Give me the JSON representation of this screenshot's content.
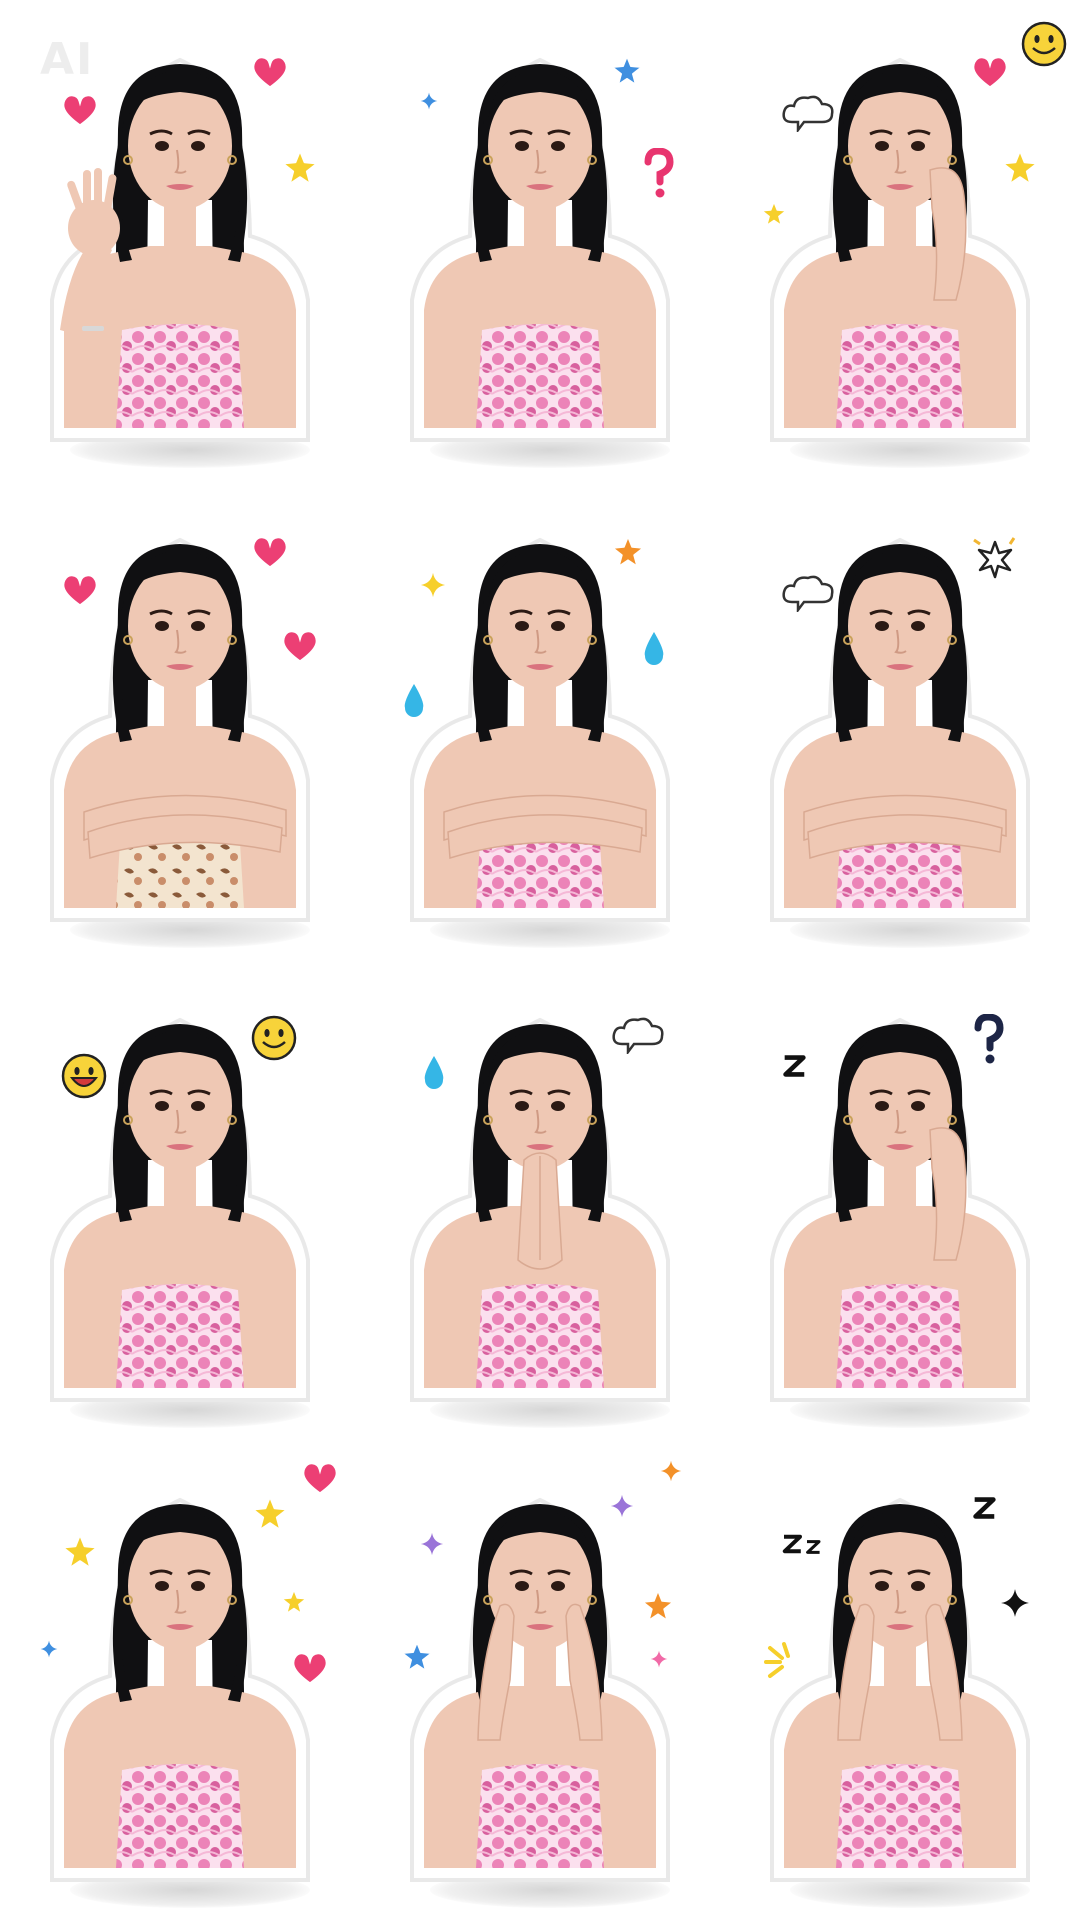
{
  "watermark": "AI",
  "colors": {
    "background": "#ffffff",
    "hair": "#101012",
    "skin": "#efc8b4",
    "dress_pink": "#ec84b8",
    "dress_light": "#fbe0ee",
    "heart": "#ec3f74",
    "star_yellow": "#f6cf2b",
    "star_blue": "#3f8fe0",
    "star_orange": "#f39129",
    "drop_blue": "#35b6e6",
    "question": "#e8356f",
    "question_dark": "#1d2546",
    "smiley": "#f7d33a"
  },
  "stickers": [
    {
      "id": "waving-hello",
      "pose": "wave",
      "outfit": "pink",
      "decos": [
        "heart",
        "heart",
        "star-yellow"
      ]
    },
    {
      "id": "laughing-wink",
      "pose": "neutral",
      "outfit": "pink",
      "decos": [
        "star-blue",
        "star-small-blue",
        "question-pink"
      ]
    },
    {
      "id": "thinking-chin-hand",
      "pose": "cheek-right",
      "outfit": "pink",
      "decos": [
        "heart",
        "cloud",
        "star-yellow",
        "star-yellow-small",
        "smiley"
      ]
    },
    {
      "id": "blowing-bubble",
      "pose": "arms-crossed",
      "outfit": "floral",
      "decos": [
        "heart",
        "heart",
        "heart"
      ]
    },
    {
      "id": "pouting-kiss",
      "pose": "arms-crossed",
      "outfit": "pink",
      "decos": [
        "star-orange",
        "sparkle-yellow",
        "drop",
        "drop"
      ]
    },
    {
      "id": "annoyed-wink",
      "pose": "arms-crossed",
      "outfit": "pink",
      "decos": [
        "burst",
        "cloud"
      ]
    },
    {
      "id": "calm-neutral",
      "pose": "neutral",
      "outfit": "pink",
      "decos": [
        "smiley",
        "smiley-grin"
      ]
    },
    {
      "id": "pleading-hands",
      "pose": "pray",
      "outfit": "pink",
      "decos": [
        "cloud",
        "drop"
      ]
    },
    {
      "id": "sleepy-frown",
      "pose": "cheek-right",
      "outfit": "pink",
      "decos": [
        "question-dark",
        "z-single"
      ]
    },
    {
      "id": "dreamy-stars",
      "pose": "neutral",
      "outfit": "pink",
      "decos": [
        "star-yellow",
        "star-yellow",
        "star-yellow-small",
        "star-small-blue",
        "heart",
        "heart"
      ]
    },
    {
      "id": "surprised-cheeks",
      "pose": "both-cheeks",
      "outfit": "pink",
      "decos": [
        "sparkle-purple",
        "sparkle-purple",
        "star-orange",
        "star-blue",
        "sparkle-orange",
        "sparkle-pink"
      ]
    },
    {
      "id": "shocked-zzz",
      "pose": "both-cheeks",
      "outfit": "pink",
      "decos": [
        "z-single",
        "zz",
        "sparkle-dark",
        "rays-yellow"
      ]
    }
  ]
}
